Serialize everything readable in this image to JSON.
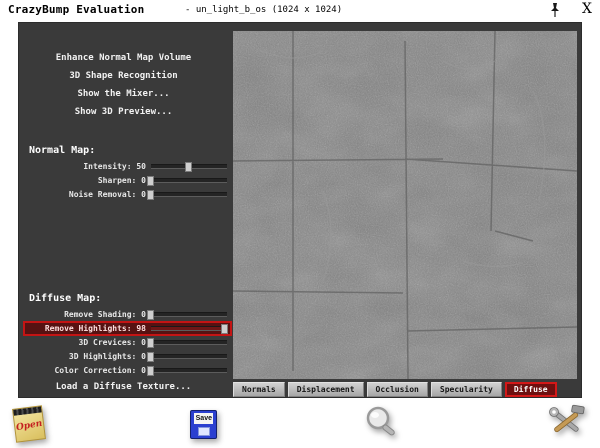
{
  "titlebar": {
    "title": "CrazyBump Evaluation",
    "document": "- un_light_b_os (1024 x 1024)",
    "close": "X"
  },
  "menu": {
    "items": [
      {
        "label": "Enhance Normal Map Volume"
      },
      {
        "label": "3D Shape Recognition"
      },
      {
        "label": "Show the Mixer..."
      },
      {
        "label": "Show 3D Preview..."
      }
    ]
  },
  "normal_map": {
    "header": "Normal Map:",
    "sliders": [
      {
        "label": "Intensity:",
        "value": 50
      },
      {
        "label": "Sharpen:",
        "value": 0
      },
      {
        "label": "Noise Removal:",
        "value": 0
      }
    ]
  },
  "diffuse_map": {
    "header": "Diffuse Map:",
    "sliders": [
      {
        "label": "Remove Shading:",
        "value": 0
      },
      {
        "label": "Remove Highlights:",
        "value": 98,
        "highlighted": true
      },
      {
        "label": "3D Crevices:",
        "value": 0
      },
      {
        "label": "3D Highlights:",
        "value": 0
      },
      {
        "label": "Color Correction:",
        "value": 0
      }
    ],
    "load_label": "Load a Diffuse Texture..."
  },
  "tabs": [
    {
      "label": "Normals",
      "active": false
    },
    {
      "label": "Displacement",
      "active": false
    },
    {
      "label": "Occlusion",
      "active": false
    },
    {
      "label": "Specularity",
      "active": false
    },
    {
      "label": "Diffuse",
      "active": true
    }
  ],
  "toolbar": {
    "open_label": "Open",
    "save_label": "Save"
  },
  "icons": {
    "titlebar": [
      "pushpin-icon",
      "close-icon"
    ],
    "bottom": [
      "open-note-icon",
      "save-floppy-icon",
      "magnifier-icon",
      "hammer-wrench-icon"
    ]
  },
  "colors": {
    "panel_gray": "#3a3a3a",
    "highlight_red": "#c41414",
    "active_tab_bg": "#6e1010",
    "tab_gray": "#b8b8b8",
    "floppy_blue": "#2a3fd0",
    "note_yellow": "#e8d27a"
  }
}
